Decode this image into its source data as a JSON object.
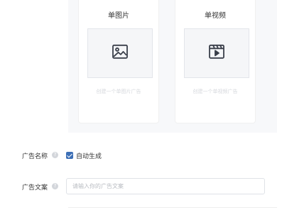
{
  "creative_types": {
    "single_image": {
      "title": "单图片",
      "hint": "创建一个单图片广告",
      "icon": "image-icon"
    },
    "single_video": {
      "title": "单视频",
      "hint": "创建一个单视频广告",
      "icon": "video-icon"
    }
  },
  "ad_name": {
    "label": "广告名称",
    "help": "?",
    "auto_generate_checked": true,
    "auto_generate_label": "自动生成"
  },
  "ad_copy": {
    "label": "广告文案",
    "help": "?",
    "placeholder": "请输入你的广告文案",
    "value": ""
  },
  "colors": {
    "accent": "#3d6fb6",
    "panel_bg": "#f7f8fa",
    "hint_text": "#d6d8dd"
  }
}
